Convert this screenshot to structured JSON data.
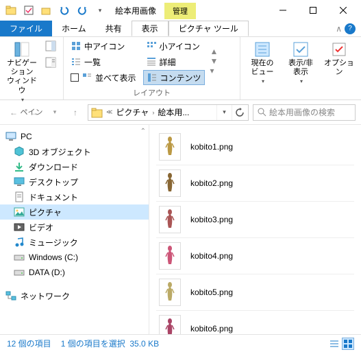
{
  "window": {
    "title": "絵本用画像",
    "manage_tab": "管理"
  },
  "tabs": {
    "file": "ファイル",
    "home": "ホーム",
    "share": "共有",
    "view": "表示",
    "picture_tools": "ピクチャ ツール"
  },
  "ribbon": {
    "group_pane": "ペイン",
    "group_layout": "レイアウト",
    "nav_pane": "ナビゲーション\nウィンドウ",
    "med_icon": "中アイコン",
    "small_icon": "小アイコン",
    "list": "一覧",
    "details": "詳細",
    "tiles": "並べて表示",
    "contents": "コンテンツ",
    "current_view": "現在の\nビュー",
    "show_hide": "表示/非\n表示",
    "options": "オプション"
  },
  "breadcrumb": {
    "seg1": "ピクチャ",
    "seg2": "絵本用..."
  },
  "search": {
    "placeholder": "絵本用画像の検索"
  },
  "tree": {
    "pc": "PC",
    "objects3d": "3D オブジェクト",
    "downloads": "ダウンロード",
    "desktop": "デスクトップ",
    "documents": "ドキュメント",
    "pictures": "ピクチャ",
    "videos": "ビデオ",
    "music": "ミュージック",
    "cdrive": "Windows (C:)",
    "ddrive": "DATA (D:)",
    "network": "ネットワーク"
  },
  "files": [
    "kobito1.png",
    "kobito2.png",
    "kobito3.png",
    "kobito4.png",
    "kobito5.png",
    "kobito6.png"
  ],
  "status": {
    "count": "12 個の項目",
    "selected": "1 個の項目を選択",
    "size": "35.0 KB"
  }
}
